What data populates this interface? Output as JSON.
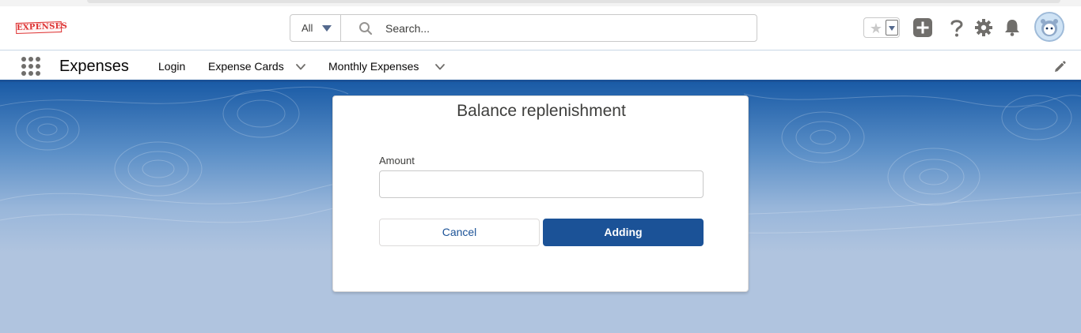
{
  "global_header": {
    "logo_text": "EXPENSES",
    "search": {
      "scope_label": "All",
      "placeholder": "Search..."
    },
    "icons": [
      "favorite-star-icon",
      "add-icon",
      "help-icon",
      "gear-icon",
      "bell-icon",
      "avatar"
    ]
  },
  "nav": {
    "app_name": "Expenses",
    "items": [
      {
        "label": "Login",
        "has_menu": false
      },
      {
        "label": "Expense Cards",
        "has_menu": true
      },
      {
        "label": "Monthly Expenses",
        "has_menu": true
      }
    ]
  },
  "modal": {
    "title": "Balance replenishment",
    "amount_label": "Amount",
    "amount_value": "",
    "cancel_label": "Cancel",
    "submit_label": "Adding"
  },
  "colors": {
    "brand_blue": "#1b5297",
    "background": "#b0c4df",
    "text": "#080707",
    "muted_icon": "#706e6b"
  }
}
